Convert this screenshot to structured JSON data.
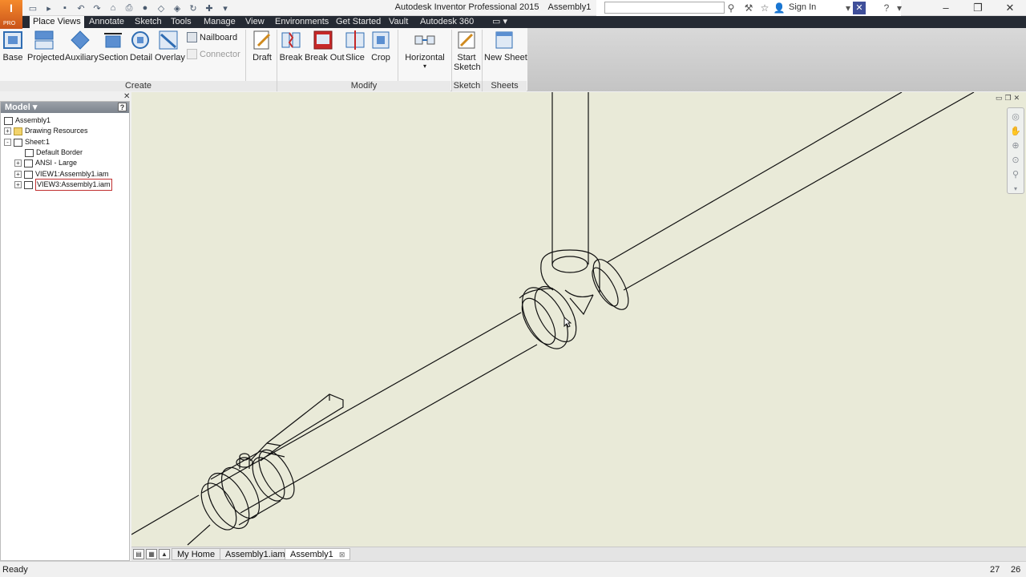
{
  "window": {
    "app_title": "Autodesk Inventor Professional 2015",
    "doc_title": "Assembly1",
    "app_badge": "I",
    "app_badge_sub": "PRO",
    "signin": "Sign In",
    "search_placeholder": ""
  },
  "ribbon_tabs": [
    "Place Views",
    "Annotate",
    "Sketch",
    "Tools",
    "Manage",
    "View",
    "Environments",
    "Get Started",
    "Vault",
    "Autodesk 360"
  ],
  "ribbon": {
    "create": {
      "label": "Create",
      "buttons": [
        "Base",
        "Projected",
        "Auxiliary",
        "Section",
        "Detail",
        "Overlay"
      ],
      "small": [
        "Nailboard",
        "Connector"
      ],
      "draft": "Draft"
    },
    "modify": {
      "label": "Modify",
      "buttons": [
        "Break",
        "Break Out",
        "Slice",
        "Crop"
      ],
      "horizontal": "Horizontal"
    },
    "sketch": {
      "label": "Sketch",
      "start_line1": "Start",
      "start_line2": "Sketch"
    },
    "sheets": {
      "label": "Sheets",
      "new_sheet": "New Sheet"
    }
  },
  "browser": {
    "title": "Model",
    "help": "?",
    "tree": [
      {
        "label": "Assembly1",
        "level": 0,
        "expander": "",
        "icon": "assembly-icon"
      },
      {
        "label": "Drawing Resources",
        "level": 1,
        "expander": "+",
        "icon": "folder-icon"
      },
      {
        "label": "Sheet:1",
        "level": 1,
        "expander": "-",
        "icon": "sheet-icon"
      },
      {
        "label": "Default Border",
        "level": 2,
        "expander": "",
        "icon": "border-icon"
      },
      {
        "label": "ANSI - Large",
        "level": 2,
        "expander": "+",
        "icon": "title-block-icon"
      },
      {
        "label": "VIEW1:Assembly1.iam",
        "level": 2,
        "expander": "+",
        "icon": "view-icon"
      },
      {
        "label": "VIEW3:Assembly1.iam",
        "level": 2,
        "expander": "+",
        "icon": "view-icon",
        "selected": true
      }
    ]
  },
  "doc_tabs": [
    "My Home",
    "Assembly1.iam",
    "Assembly1"
  ],
  "status": {
    "text": "Ready",
    "num1": "27",
    "num2": "26"
  },
  "colors": {
    "canvas_bg": "#e9ead8",
    "tab_bar_bg": "#252a33",
    "app_orange": "#e06a22"
  }
}
